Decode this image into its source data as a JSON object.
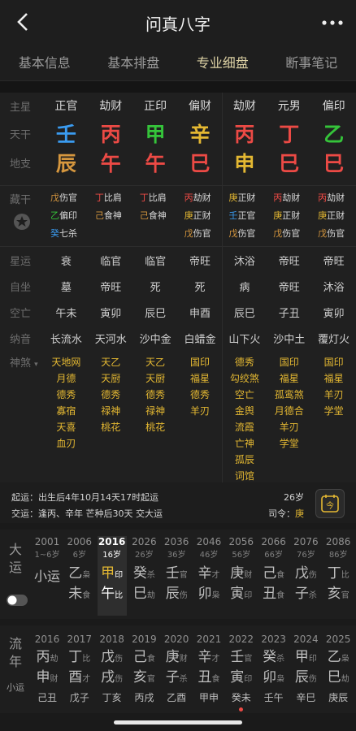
{
  "nav": {
    "title": "问真八字"
  },
  "tabs": [
    "基本信息",
    "基本排盘",
    "专业细盘",
    "断事笔记"
  ],
  "labels": {
    "zhuxing": "主星",
    "tiangan": "天干",
    "dizhi": "地支",
    "canggan": "藏干",
    "xingyun": "星运",
    "zizuo": "自坐",
    "kongwang": "空亡",
    "nayin": "纳音",
    "shensha": "神煞"
  },
  "zhuxing": [
    "正官",
    "劫财",
    "正印",
    "偏财",
    "劫财",
    "元男",
    "偏印"
  ],
  "tiangan": [
    {
      "t": "壬",
      "c": "#3a9bf0"
    },
    {
      "t": "丙",
      "c": "#ec4a45"
    },
    {
      "t": "甲",
      "c": "#35c43a"
    },
    {
      "t": "辛",
      "c": "#e4b832"
    },
    {
      "t": "丙",
      "c": "#ec4a45"
    },
    {
      "t": "丁",
      "c": "#ec4a45"
    },
    {
      "t": "乙",
      "c": "#35c43a"
    }
  ],
  "dizhi": [
    {
      "t": "辰",
      "c": "#d6973e"
    },
    {
      "t": "午",
      "c": "#ec4a45"
    },
    {
      "t": "午",
      "c": "#ec4a45"
    },
    {
      "t": "巳",
      "c": "#ec4a45"
    },
    {
      "t": "申",
      "c": "#e4b832"
    },
    {
      "t": "巳",
      "c": "#ec4a45"
    },
    {
      "t": "巳",
      "c": "#ec4a45"
    }
  ],
  "canggan": [
    [
      {
        "g": "戊",
        "c": "#d6973e",
        "s": "伤官"
      },
      {
        "g": "乙",
        "c": "#35c43a",
        "s": "偏印"
      },
      {
        "g": "癸",
        "c": "#3a9bf0",
        "s": "七杀"
      }
    ],
    [
      {
        "g": "丁",
        "c": "#ec4a45",
        "s": "比肩"
      },
      {
        "g": "己",
        "c": "#d6973e",
        "s": "食神"
      }
    ],
    [
      {
        "g": "丁",
        "c": "#ec4a45",
        "s": "比肩"
      },
      {
        "g": "己",
        "c": "#d6973e",
        "s": "食神"
      }
    ],
    [
      {
        "g": "丙",
        "c": "#ec4a45",
        "s": "劫财"
      },
      {
        "g": "庚",
        "c": "#e4b832",
        "s": "正财"
      },
      {
        "g": "戊",
        "c": "#d6973e",
        "s": "伤官"
      }
    ],
    [
      {
        "g": "庚",
        "c": "#e4b832",
        "s": "正财"
      },
      {
        "g": "壬",
        "c": "#3a9bf0",
        "s": "正官"
      },
      {
        "g": "戊",
        "c": "#d6973e",
        "s": "伤官"
      }
    ],
    [
      {
        "g": "丙",
        "c": "#ec4a45",
        "s": "劫财"
      },
      {
        "g": "庚",
        "c": "#e4b832",
        "s": "正财"
      },
      {
        "g": "戊",
        "c": "#d6973e",
        "s": "伤官"
      }
    ],
    [
      {
        "g": "丙",
        "c": "#ec4a45",
        "s": "劫财"
      },
      {
        "g": "庚",
        "c": "#e4b832",
        "s": "正财"
      },
      {
        "g": "戊",
        "c": "#d6973e",
        "s": "伤官"
      }
    ]
  ],
  "xingyun": [
    "衰",
    "临官",
    "临官",
    "帝旺",
    "沐浴",
    "帝旺",
    "帝旺"
  ],
  "zizuo": [
    "墓",
    "帝旺",
    "死",
    "死",
    "病",
    "帝旺",
    "沐浴"
  ],
  "kongwang": [
    "午未",
    "寅卯",
    "辰巳",
    "申酉",
    "辰巳",
    "子丑",
    "寅卯"
  ],
  "nayin": [
    "长流水",
    "天河水",
    "沙中金",
    "白蜡金",
    "山下火",
    "沙中土",
    "覆灯火"
  ],
  "shensha": [
    [
      "天地网",
      "月德",
      "德秀",
      "寡宿",
      "天喜",
      "血刃"
    ],
    [
      "天乙",
      "天厨",
      "德秀",
      "禄神",
      "桃花"
    ],
    [
      "天乙",
      "天厨",
      "德秀",
      "禄神",
      "桃花"
    ],
    [
      "国印",
      "福星",
      "德秀",
      "羊刃"
    ],
    [
      "德秀",
      "勾绞煞",
      "空亡",
      "金舆",
      "流霞",
      "亡神",
      "孤辰",
      "词馆"
    ],
    [
      "国印",
      "福星",
      "孤鸾煞",
      "月德合",
      "羊刃",
      "学堂"
    ],
    [
      "国印",
      "福星",
      "羊刃",
      "学堂"
    ]
  ],
  "shenshaColors": [
    "#e4b832",
    "#e4b832",
    "#e4b832",
    "#e4b832",
    "#e4b832",
    "#e4b832",
    "#e4b832"
  ],
  "info": {
    "qiyun": "起运：出生后4年10月14天17时起运",
    "jiaoyun": "交运：逢丙、辛年 芒种后30天 交大运",
    "age": "26岁",
    "siling": "司令：",
    "siling_val": "庚"
  },
  "dayun": {
    "label": "大运",
    "items": [
      {
        "yr": "2001",
        "ag": "1~6岁",
        "gz": "小运",
        "sub": ""
      },
      {
        "yr": "2006",
        "ag": "6岁",
        "g": "乙",
        "gs": "枭",
        "z": "未",
        "zs": "食"
      },
      {
        "yr": "2016",
        "ag": "16岁",
        "g": "甲",
        "gs": "印",
        "z": "午",
        "zs": "比"
      },
      {
        "yr": "2026",
        "ag": "26岁",
        "g": "癸",
        "gs": "杀",
        "z": "巳",
        "zs": "劫"
      },
      {
        "yr": "2036",
        "ag": "36岁",
        "g": "壬",
        "gs": "官",
        "z": "辰",
        "zs": "伤"
      },
      {
        "yr": "2046",
        "ag": "46岁",
        "g": "辛",
        "gs": "才",
        "z": "卯",
        "zs": "枭"
      },
      {
        "yr": "2056",
        "ag": "56岁",
        "g": "庚",
        "gs": "财",
        "z": "寅",
        "zs": "印"
      },
      {
        "yr": "2066",
        "ag": "66岁",
        "g": "己",
        "gs": "食",
        "z": "丑",
        "zs": "食"
      },
      {
        "yr": "2076",
        "ag": "76岁",
        "g": "戊",
        "gs": "伤",
        "z": "子",
        "zs": "杀"
      },
      {
        "yr": "2086",
        "ag": "86岁",
        "g": "丁",
        "gs": "比",
        "z": "亥",
        "zs": "官"
      }
    ]
  },
  "liunian": {
    "label": "流年",
    "sub": "小运",
    "items": [
      {
        "yr": "2016",
        "g": "丙",
        "gs": "劫",
        "z": "申",
        "zs": "财",
        "x": "己丑"
      },
      {
        "yr": "2017",
        "g": "丁",
        "gs": "比",
        "z": "酉",
        "zs": "才",
        "x": "戊子"
      },
      {
        "yr": "2018",
        "g": "戊",
        "gs": "伤",
        "z": "戌",
        "zs": "伤",
        "x": "丁亥"
      },
      {
        "yr": "2019",
        "g": "己",
        "gs": "食",
        "z": "亥",
        "zs": "官",
        "x": "丙戌"
      },
      {
        "yr": "2020",
        "g": "庚",
        "gs": "财",
        "z": "子",
        "zs": "杀",
        "x": "乙酉"
      },
      {
        "yr": "2021",
        "g": "辛",
        "gs": "才",
        "z": "丑",
        "zs": "食",
        "x": "甲申"
      },
      {
        "yr": "2022",
        "g": "壬",
        "gs": "官",
        "z": "寅",
        "zs": "印",
        "x": "癸未"
      },
      {
        "yr": "2023",
        "g": "癸",
        "gs": "杀",
        "z": "卯",
        "zs": "枭",
        "x": "壬午"
      },
      {
        "yr": "2024",
        "g": "甲",
        "gs": "印",
        "z": "辰",
        "zs": "伤",
        "x": "辛巳"
      },
      {
        "yr": "2025",
        "g": "乙",
        "gs": "枭",
        "z": "巳",
        "zs": "劫",
        "x": "庚辰"
      }
    ]
  }
}
